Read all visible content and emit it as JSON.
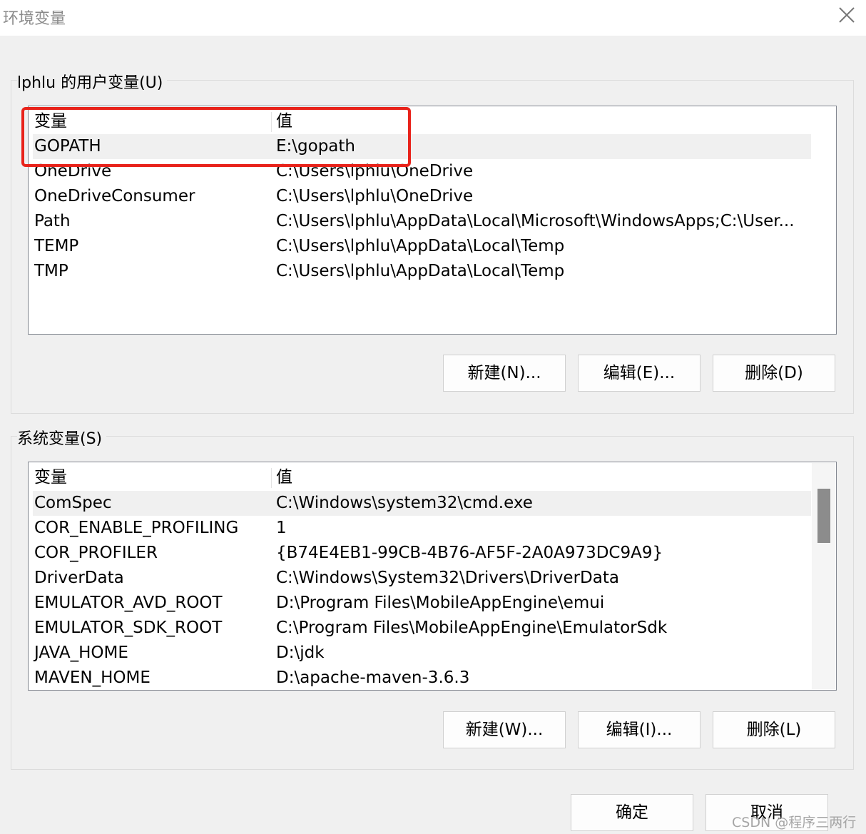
{
  "window": {
    "title": "环境变量"
  },
  "user_vars": {
    "group_label": "lphlu 的用户变量(U)",
    "header": {
      "name": "变量",
      "value": "值"
    },
    "rows": [
      {
        "name": "GOPATH",
        "value": "E:\\gopath"
      },
      {
        "name": "OneDrive",
        "value": "C:\\Users\\lphlu\\OneDrive"
      },
      {
        "name": "OneDriveConsumer",
        "value": "C:\\Users\\lphlu\\OneDrive"
      },
      {
        "name": "Path",
        "value": "C:\\Users\\lphlu\\AppData\\Local\\Microsoft\\WindowsApps;C:\\User..."
      },
      {
        "name": "TEMP",
        "value": "C:\\Users\\lphlu\\AppData\\Local\\Temp"
      },
      {
        "name": "TMP",
        "value": "C:\\Users\\lphlu\\AppData\\Local\\Temp"
      }
    ],
    "buttons": {
      "new": "新建(N)...",
      "edit": "编辑(E)...",
      "delete": "删除(D)"
    }
  },
  "system_vars": {
    "group_label": "系统变量(S)",
    "header": {
      "name": "变量",
      "value": "值"
    },
    "rows": [
      {
        "name": "ComSpec",
        "value": "C:\\Windows\\system32\\cmd.exe"
      },
      {
        "name": "COR_ENABLE_PROFILING",
        "value": "1"
      },
      {
        "name": "COR_PROFILER",
        "value": "{B74E4EB1-99CB-4B76-AF5F-2A0A973DC9A9}"
      },
      {
        "name": "DriverData",
        "value": "C:\\Windows\\System32\\Drivers\\DriverData"
      },
      {
        "name": "EMULATOR_AVD_ROOT",
        "value": "D:\\Program Files\\MobileAppEngine\\emui"
      },
      {
        "name": "EMULATOR_SDK_ROOT",
        "value": "C:\\Program Files\\MobileAppEngine\\EmulatorSdk"
      },
      {
        "name": "JAVA_HOME",
        "value": "D:\\jdk"
      },
      {
        "name": "MAVEN_HOME",
        "value": "D:\\apache-maven-3.6.3"
      }
    ],
    "buttons": {
      "new": "新建(W)...",
      "edit": "编辑(I)...",
      "delete": "删除(L)"
    }
  },
  "dialog_buttons": {
    "ok": "确定",
    "cancel": "取消"
  },
  "watermark": "CSDN @程序三两行",
  "icons": {
    "close": "close-icon"
  },
  "colors": {
    "highlight": "#e8231b",
    "selection": "#f0f0f0",
    "scroll_thumb": "#8c8c8c"
  }
}
